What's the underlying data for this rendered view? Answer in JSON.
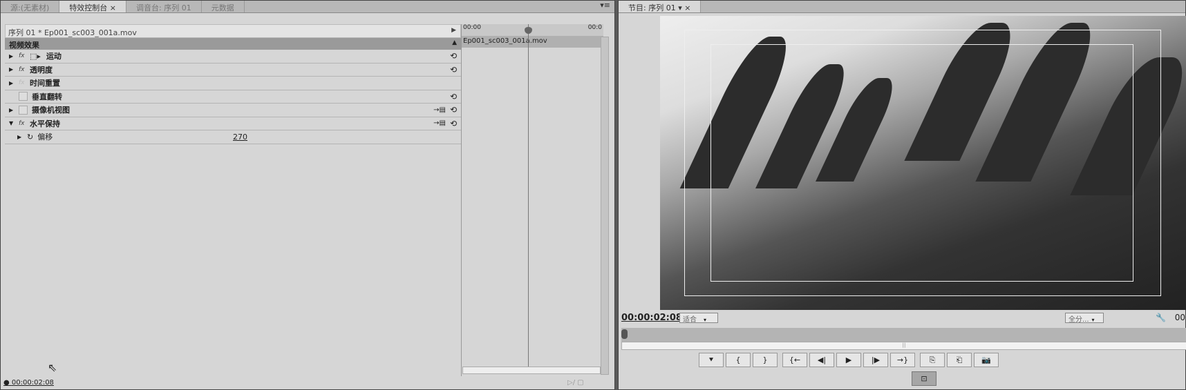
{
  "left_panel": {
    "tabs": [
      "源:(无素材)",
      "特效控制台 ×",
      "调音台: 序列 01",
      "元数据"
    ],
    "menu_icon": "▾≡",
    "clip_header": "序列 01 * Ep001_sc003_001a.mov",
    "section": "视频效果",
    "effects": [
      {
        "label": "运动",
        "expand": "▶",
        "fx": "fx",
        "reset": "⟲"
      },
      {
        "label": "透明度",
        "expand": "▶",
        "fx": "fx",
        "reset": "⟲"
      },
      {
        "label": "时间重置",
        "expand": "▶",
        "fx": "fx",
        "reset": ""
      },
      {
        "label": "垂直翻转",
        "expand": "",
        "fx": "",
        "reset": "⟲"
      },
      {
        "label": "摄像机视图",
        "expand": "▶",
        "fx": "",
        "reset": "⟲"
      },
      {
        "label": "水平保持",
        "expand": "▼",
        "fx": "fx",
        "reset": "⟲"
      }
    ],
    "param": {
      "label": "偏移",
      "value": "270"
    },
    "timeline": {
      "start": "00:00",
      "end": "00:0",
      "clip": "Ep001_sc003_001a.mov"
    },
    "timecode": "00:00:02:08"
  },
  "right_panel": {
    "tab": "节目: 序列 01",
    "timecode": "00:00:02:08",
    "fit": "适合",
    "resolution": "全分...",
    "duration_partial": "00",
    "buttons": [
      "⯆",
      "{",
      "}",
      "{←",
      "◀|",
      "▶",
      "|▶",
      "→}",
      "⎘",
      "⎗",
      "📷"
    ],
    "safe_margins_icon": "⊡"
  }
}
